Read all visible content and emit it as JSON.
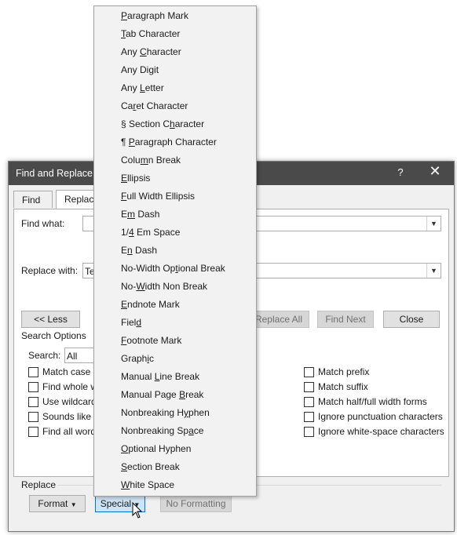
{
  "dialog": {
    "title": "Find and Replace",
    "help_label": "?",
    "close_label": "✕",
    "tabs": [
      {
        "label": "Find",
        "selected": false
      },
      {
        "label": "Replace",
        "selected": true
      }
    ],
    "find_what_label": "Find what:",
    "find_what_value": "",
    "replace_with_label": "Replace with:",
    "replace_with_value": "Te",
    "less_button": "<< Less",
    "replace_all_button": "Replace All",
    "find_next_button": "Find Next",
    "close_button": "Close",
    "search_options_label": "Search Options",
    "search_label": "Search:",
    "search_value": "All",
    "left_options": [
      "Match case",
      "Find whole w",
      "Use wildcard",
      "Sounds like (",
      "Find all word"
    ],
    "right_options": [
      "Match prefix",
      "Match suffix",
      "Match half/full width forms",
      "Ignore punctuation characters",
      "Ignore white-space characters"
    ],
    "replace_section_label": "Replace",
    "format_button": "Format",
    "special_button": "Special",
    "no_formatting_button": "No Formatting"
  },
  "special_menu": {
    "items": [
      "Paragraph Mark",
      "Tab Character",
      "Any Character",
      "Any Digit",
      "Any Letter",
      "Caret Character",
      "§ Section Character",
      "¶ Paragraph Character",
      "Column Break",
      "Ellipsis",
      "Full Width Ellipsis",
      "Em Dash",
      "1/4 Em Space",
      "En Dash",
      "No-Width Optional Break",
      "No-Width Non Break",
      "Endnote Mark",
      "Field",
      "Footnote Mark",
      "Graphic",
      "Manual Line Break",
      "Manual Page Break",
      "Nonbreaking Hyphen",
      "Nonbreaking Space",
      "Optional Hyphen",
      "Section Break",
      "White Space"
    ]
  }
}
